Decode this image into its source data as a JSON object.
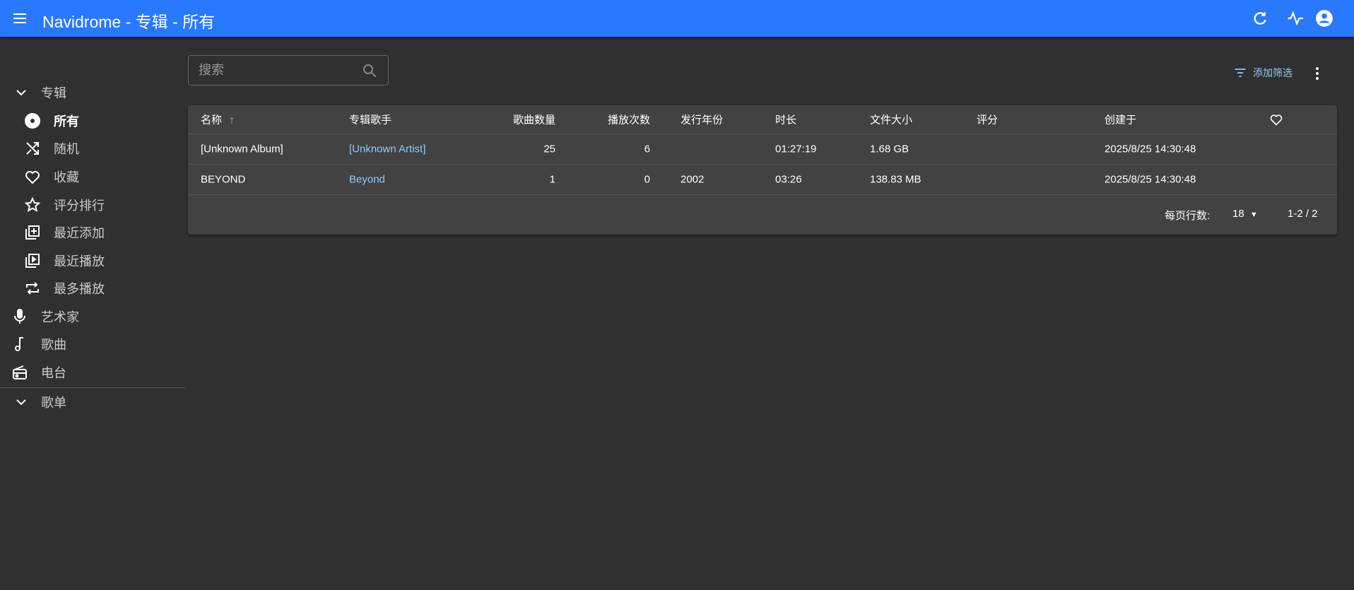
{
  "header": {
    "title": "Navidrome - 专辑 - 所有"
  },
  "sidebar": {
    "albums_label": "专辑",
    "album_items": [
      {
        "label": "所有"
      },
      {
        "label": "随机"
      },
      {
        "label": "收藏"
      },
      {
        "label": "评分排行"
      },
      {
        "label": "最近添加"
      },
      {
        "label": "最近播放"
      },
      {
        "label": "最多播放"
      }
    ],
    "artists": "艺术家",
    "songs": "歌曲",
    "radio": "电台",
    "playlists": "歌单"
  },
  "toolbar": {
    "search_placeholder": "搜索",
    "add_filter": "添加筛选"
  },
  "table": {
    "columns": {
      "name": "名称",
      "artist": "专辑歌手",
      "songs": "歌曲数量",
      "plays": "播放次数",
      "year": "发行年份",
      "duration": "时长",
      "size": "文件大小",
      "rating": "评分",
      "created": "创建于"
    },
    "rows": [
      {
        "name": "[Unknown Album]",
        "artist": "[Unknown Artist]",
        "songs": "25",
        "plays": "6",
        "year": "",
        "duration": "01:27:19",
        "size": "1.68 GB",
        "rating": "",
        "created": "2025/8/25 14:30:48"
      },
      {
        "name": "BEYOND",
        "artist": "Beyond",
        "songs": "1",
        "plays": "0",
        "year": "2002",
        "duration": "03:26",
        "size": "138.83 MB",
        "rating": "",
        "created": "2025/8/25 14:30:48"
      }
    ],
    "pagination": {
      "rows_per_page_label": "每页行数:",
      "rows_per_page": "18",
      "range": "1-2 / 2"
    }
  },
  "colors": {
    "appbar": "#2979ff",
    "link": "#90caf9",
    "background": "#303030",
    "card": "#424242"
  }
}
